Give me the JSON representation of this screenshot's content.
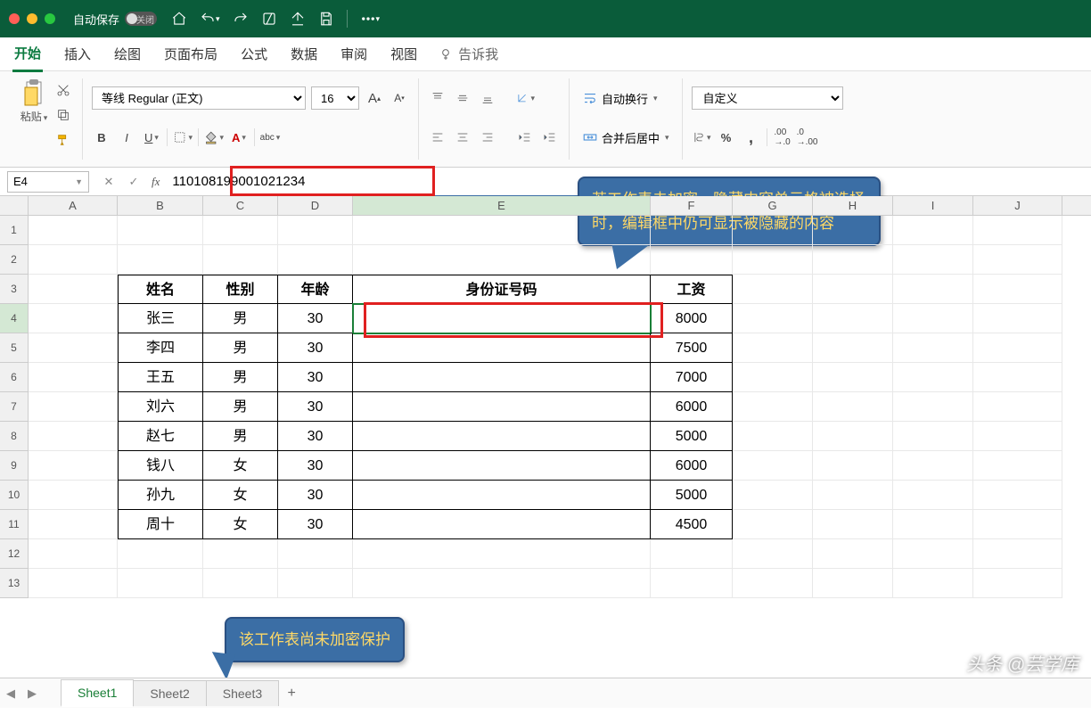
{
  "titlebar": {
    "autosave_label": "自动保存",
    "autosave_state": "关闭"
  },
  "tabs": {
    "items": [
      "开始",
      "插入",
      "绘图",
      "页面布局",
      "公式",
      "数据",
      "审阅",
      "视图"
    ],
    "active": "开始",
    "tell_me": "告诉我"
  },
  "ribbon": {
    "paste": "粘贴",
    "font_name": "等线 Regular (正文)",
    "font_size": "16",
    "wrap_text": "自动换行",
    "merge": "合并后居中",
    "number_format": "自定义"
  },
  "formula_bar": {
    "cell_ref": "E4",
    "value": "110108199001021234"
  },
  "columns": [
    "A",
    "B",
    "C",
    "D",
    "E",
    "F",
    "G",
    "H",
    "I",
    "J"
  ],
  "row_numbers": [
    "1",
    "2",
    "3",
    "4",
    "5",
    "6",
    "7",
    "8",
    "9",
    "10",
    "11",
    "12",
    "13"
  ],
  "table": {
    "headers": {
      "b": "姓名",
      "c": "性别",
      "d": "年龄",
      "e": "身份证号码",
      "f": "工资"
    },
    "rows": [
      {
        "b": "张三",
        "c": "男",
        "d": "30",
        "e": "",
        "f": "8000"
      },
      {
        "b": "李四",
        "c": "男",
        "d": "30",
        "e": "",
        "f": "7500"
      },
      {
        "b": "王五",
        "c": "男",
        "d": "30",
        "e": "",
        "f": "7000"
      },
      {
        "b": "刘六",
        "c": "男",
        "d": "30",
        "e": "",
        "f": "6000"
      },
      {
        "b": "赵七",
        "c": "男",
        "d": "30",
        "e": "",
        "f": "5000"
      },
      {
        "b": "钱八",
        "c": "女",
        "d": "30",
        "e": "",
        "f": "6000"
      },
      {
        "b": "孙九",
        "c": "女",
        "d": "30",
        "e": "",
        "f": "5000"
      },
      {
        "b": "周十",
        "c": "女",
        "d": "30",
        "e": "",
        "f": "4500"
      }
    ]
  },
  "callouts": {
    "c1": "若工作表未加密，隐藏内容单元格被选择时，编辑框中仍可显示被隐藏的内容",
    "c2": "该工作表尚未加密保护"
  },
  "sheets": {
    "items": [
      "Sheet1",
      "Sheet2",
      "Sheet3"
    ],
    "active": "Sheet1"
  },
  "watermark": "头条 @芸学库"
}
